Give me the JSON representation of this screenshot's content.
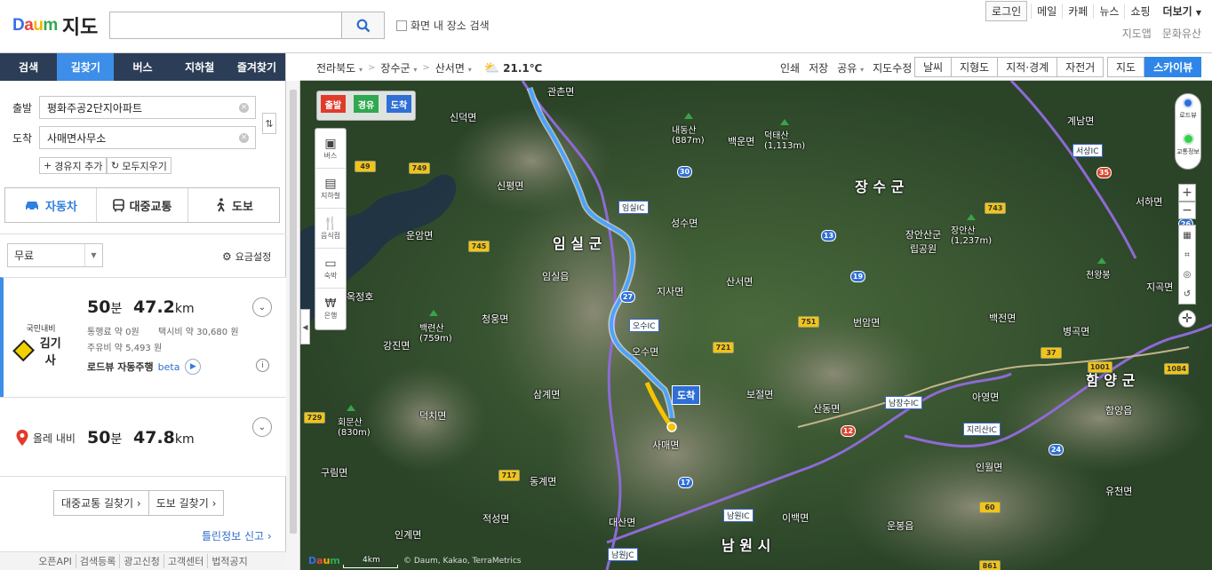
{
  "header": {
    "brand": [
      "D",
      "a",
      "u",
      "m"
    ],
    "service_name": "지도",
    "search_placeholder": "",
    "screen_search_label": "화면 내 장소 검색",
    "gnb": {
      "login": "로그인",
      "links": [
        "메일",
        "카페",
        "뉴스",
        "쇼핑"
      ],
      "more": "더보기"
    },
    "sub_links": [
      "지도앱",
      "문화유산"
    ]
  },
  "sidebar": {
    "tabs": [
      {
        "label": "검색",
        "active": false
      },
      {
        "label": "길찾기",
        "active": true
      },
      {
        "label": "버스",
        "active": false
      },
      {
        "label": "지하철",
        "active": false
      },
      {
        "label": "즐겨찾기",
        "active": false
      }
    ],
    "origin": {
      "label": "출발",
      "value": "평화주공2단지아파트"
    },
    "destination": {
      "label": "도착",
      "value": "사매면사무소"
    },
    "add_waypoint": "경유지 추가",
    "clear_all": "모두지우기",
    "modes": [
      {
        "label": "자동차",
        "icon": "car-icon",
        "active": true
      },
      {
        "label": "대중교통",
        "icon": "bus-icon",
        "active": false
      },
      {
        "label": "도보",
        "icon": "walk-icon",
        "active": false
      }
    ],
    "toll_option": "무료",
    "fee_setting": "요금설정",
    "routes": [
      {
        "provider_small": "국민내비",
        "provider": "김기사",
        "time_num": "50",
        "time_unit": "분",
        "dist_num": "47.2",
        "dist_unit": "km",
        "toll": "통행료 약 0원",
        "taxi": "택시비 약 30,680 원",
        "fuel": "주유비 약 5,493 원",
        "roadview": "로드뷰 자동주행",
        "beta": "beta"
      },
      {
        "provider": "올레 내비",
        "time_num": "50",
        "time_unit": "분",
        "dist_num": "47.8",
        "dist_unit": "km"
      }
    ],
    "transit_btn": "대중교통 길찾기",
    "walk_btn": "도보 길찾기",
    "report": "틀린정보 신고",
    "footer": [
      "오픈API",
      "검색등록",
      "광고신청",
      "고객센터",
      "법적공지"
    ]
  },
  "mapbar": {
    "crumbs": [
      "전라북도",
      "장수군",
      "산서면"
    ],
    "temperature": "21.1℃",
    "tools": [
      "인쇄",
      "저장",
      "공유",
      "지도수정"
    ],
    "layers": [
      "날씨",
      "지형도",
      "지적·경계",
      "자전거"
    ],
    "views": [
      {
        "label": "지도",
        "active": false
      },
      {
        "label": "스카이뷰",
        "active": true
      }
    ]
  },
  "map": {
    "markers": {
      "start": "출발",
      "via": "경유",
      "end": "도착"
    },
    "categories": [
      "버스",
      "지하철",
      "음식점",
      "숙박",
      "은행"
    ],
    "roadview_label": "로드뷰",
    "traffic_label": "교통정보",
    "dest_flag": "도착",
    "scale": "4km",
    "copyright": "© Daum, Kakao, TerraMetrics",
    "logo": "Daum",
    "colors": {
      "route_blue": "#4aa3ff",
      "route_yellow": "#f5c400",
      "expressway": "#8e6ad6"
    },
    "places": [
      {
        "name": "임 실 군",
        "big": true
      },
      {
        "name": "장 수 군",
        "big": true
      },
      {
        "name": "남 원 시",
        "big": true
      },
      {
        "name": "함 양 군",
        "big": true
      },
      {
        "name": "관촌면"
      },
      {
        "name": "신덕면"
      },
      {
        "name": "신평면"
      },
      {
        "name": "운암면"
      },
      {
        "name": "임실읍"
      },
      {
        "name": "청웅면"
      },
      {
        "name": "강진면"
      },
      {
        "name": "덕치면"
      },
      {
        "name": "삼계면"
      },
      {
        "name": "지사면"
      },
      {
        "name": "산서면"
      },
      {
        "name": "성수면"
      },
      {
        "name": "백운면"
      },
      {
        "name": "번암면"
      },
      {
        "name": "오수면"
      },
      {
        "name": "보절면"
      },
      {
        "name": "산동면"
      },
      {
        "name": "사매면"
      },
      {
        "name": "동계면"
      },
      {
        "name": "대산면"
      },
      {
        "name": "구림면"
      },
      {
        "name": "적성면"
      },
      {
        "name": "인계면"
      },
      {
        "name": "이백면"
      },
      {
        "name": "아영면"
      },
      {
        "name": "인월면"
      },
      {
        "name": "운봉읍"
      },
      {
        "name": "함양읍"
      },
      {
        "name": "유천면"
      },
      {
        "name": "백전면"
      },
      {
        "name": "병곡면"
      },
      {
        "name": "서하면"
      },
      {
        "name": "계남면"
      },
      {
        "name": "지곡면"
      },
      {
        "name": "장안산군립공원"
      },
      {
        "name": "옥정호"
      }
    ],
    "mountains": [
      {
        "name": "내동산",
        "height": "(887m)"
      },
      {
        "name": "덕태산",
        "height": "(1,113m)"
      },
      {
        "name": "장안산",
        "height": "(1,237m)"
      },
      {
        "name": "백련산",
        "height": "(759m)"
      },
      {
        "name": "회문산",
        "height": "(830m)"
      },
      {
        "name": "천왕봉",
        "height": ""
      }
    ],
    "ics": [
      "임실IC",
      "오수IC",
      "남장수IC",
      "지리산IC",
      "서상IC",
      "남원IC",
      "남원JC"
    ],
    "route_shields": [
      "749",
      "30",
      "49",
      "745",
      "27",
      "13",
      "19",
      "751",
      "721",
      "743",
      "37",
      "1001",
      "1084",
      "12",
      "24",
      "717",
      "17",
      "729",
      "60",
      "861",
      "26",
      "35"
    ]
  }
}
